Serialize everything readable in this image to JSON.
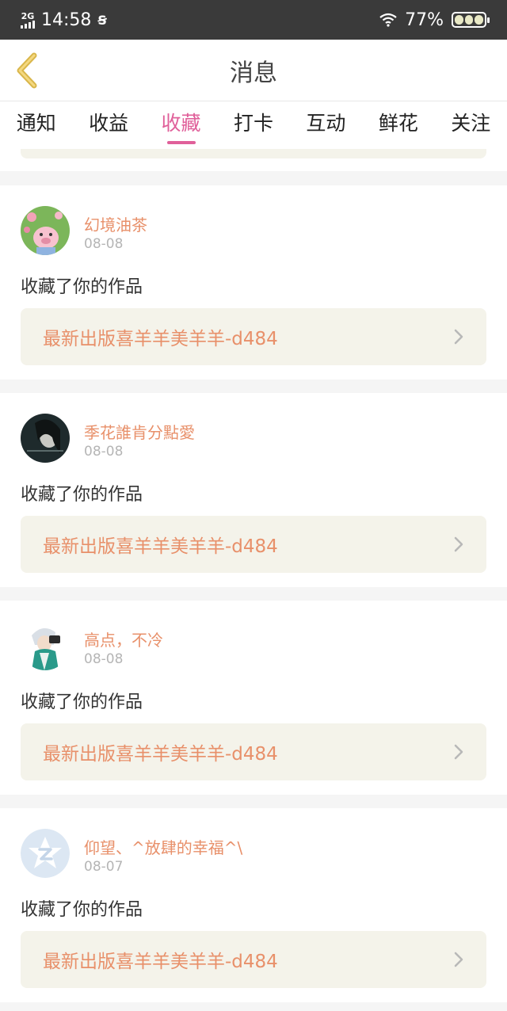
{
  "status_bar": {
    "network": "2G",
    "time": "14:58",
    "notification_icon": "ts-icon",
    "battery": "77%"
  },
  "nav": {
    "title": "消息",
    "back_icon": "chevron-left-icon"
  },
  "tabs": [
    {
      "label": "通知",
      "active": false
    },
    {
      "label": "收益",
      "active": false
    },
    {
      "label": "收藏",
      "active": true
    },
    {
      "label": "打卡",
      "active": false
    },
    {
      "label": "互动",
      "active": false
    },
    {
      "label": "鲜花",
      "active": false
    },
    {
      "label": "关注",
      "active": false
    }
  ],
  "items": [
    {
      "name": "幻境油茶",
      "date": "08-08",
      "action": "收藏了你的作品",
      "work": "最新出版喜羊羊美羊羊-d484",
      "avatar": "pig-avatar"
    },
    {
      "name": "季花誰肯分點愛",
      "date": "08-08",
      "action": "收藏了你的作品",
      "work": "最新出版喜羊羊美羊羊-d484",
      "avatar": "girl-avatar"
    },
    {
      "name": "高点，不冷",
      "date": "08-08",
      "action": "收藏了你的作品",
      "work": "最新出版喜羊羊美羊羊-d484",
      "avatar": "anime-avatar"
    },
    {
      "name": "仰望、^放肆的幸福^\\",
      "date": "08-07",
      "action": "收藏了你的作品",
      "work": "最新出版喜羊羊美羊羊-d484",
      "avatar": "qq-default-avatar"
    }
  ],
  "colors": {
    "accent": "#e0609a",
    "username": "#e8906a",
    "work_bg": "#f4f3ea",
    "status_bar": "#3a3a3a"
  }
}
